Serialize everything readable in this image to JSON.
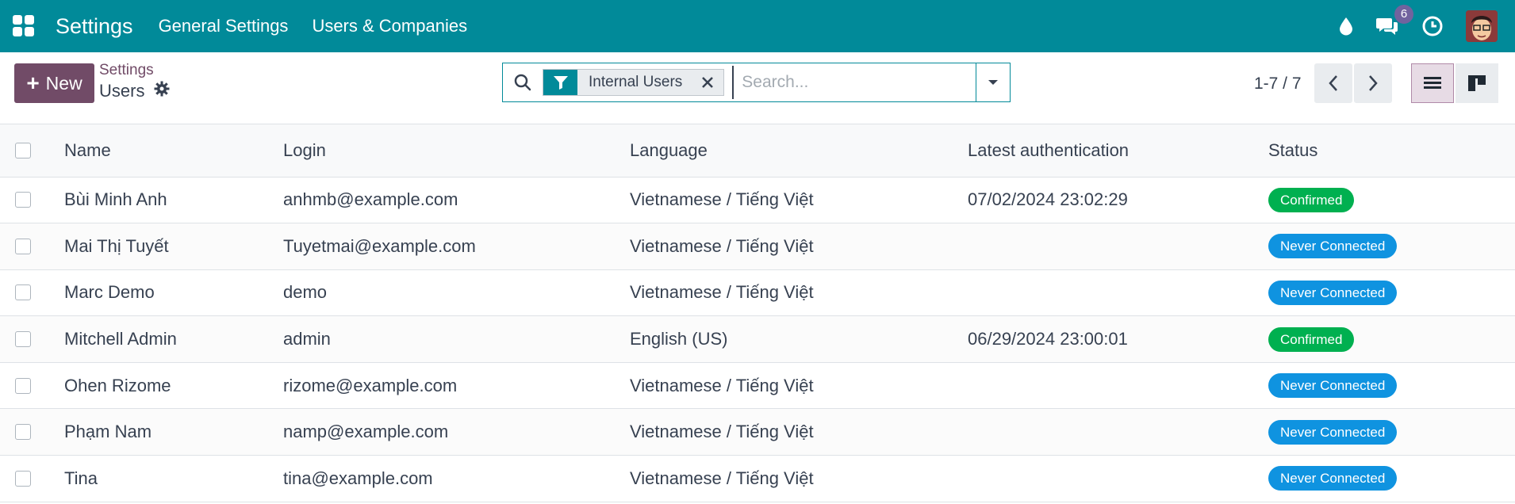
{
  "navbar": {
    "app_title": "Settings",
    "menu": [
      "General Settings",
      "Users & Companies"
    ],
    "messages_badge": "6",
    "icons": [
      "apps-grid-icon",
      "droplet-icon",
      "chat-icon",
      "clock-icon"
    ]
  },
  "control_panel": {
    "new_label": "New",
    "breadcrumb_parent": "Settings",
    "breadcrumb_current": "Users",
    "search": {
      "facet_label": "Internal Users",
      "placeholder": "Search..."
    },
    "pager": "1-7 / 7"
  },
  "table": {
    "columns": [
      "Name",
      "Login",
      "Language",
      "Latest authentication",
      "Status"
    ],
    "rows": [
      {
        "name": "Bùi Minh Anh",
        "login": "anhmb@example.com",
        "language": "Vietnamese / Tiếng Việt",
        "latest_auth": "07/02/2024 23:02:29",
        "status": "Confirmed"
      },
      {
        "name": "Mai Thị Tuyết",
        "login": "Tuyetmai@example.com",
        "language": "Vietnamese / Tiếng Việt",
        "latest_auth": "",
        "status": "Never Connected"
      },
      {
        "name": "Marc Demo",
        "login": "demo",
        "language": "Vietnamese / Tiếng Việt",
        "latest_auth": "",
        "status": "Never Connected"
      },
      {
        "name": "Mitchell Admin",
        "login": "admin",
        "language": "English (US)",
        "latest_auth": "06/29/2024 23:00:01",
        "status": "Confirmed"
      },
      {
        "name": "Ohen Rizome",
        "login": "rizome@example.com",
        "language": "Vietnamese / Tiếng Việt",
        "latest_auth": "",
        "status": "Never Connected"
      },
      {
        "name": "Phạm Nam",
        "login": "namp@example.com",
        "language": "Vietnamese / Tiếng Việt",
        "latest_auth": "",
        "status": "Never Connected"
      },
      {
        "name": "Tina",
        "login": "tina@example.com",
        "language": "Vietnamese / Tiếng Việt",
        "latest_auth": "",
        "status": "Never Connected"
      }
    ]
  },
  "colors": {
    "navbar": "#018a99",
    "primary": "#714b67",
    "confirmed": "#00b050",
    "never_connected": "#0f93e0"
  }
}
